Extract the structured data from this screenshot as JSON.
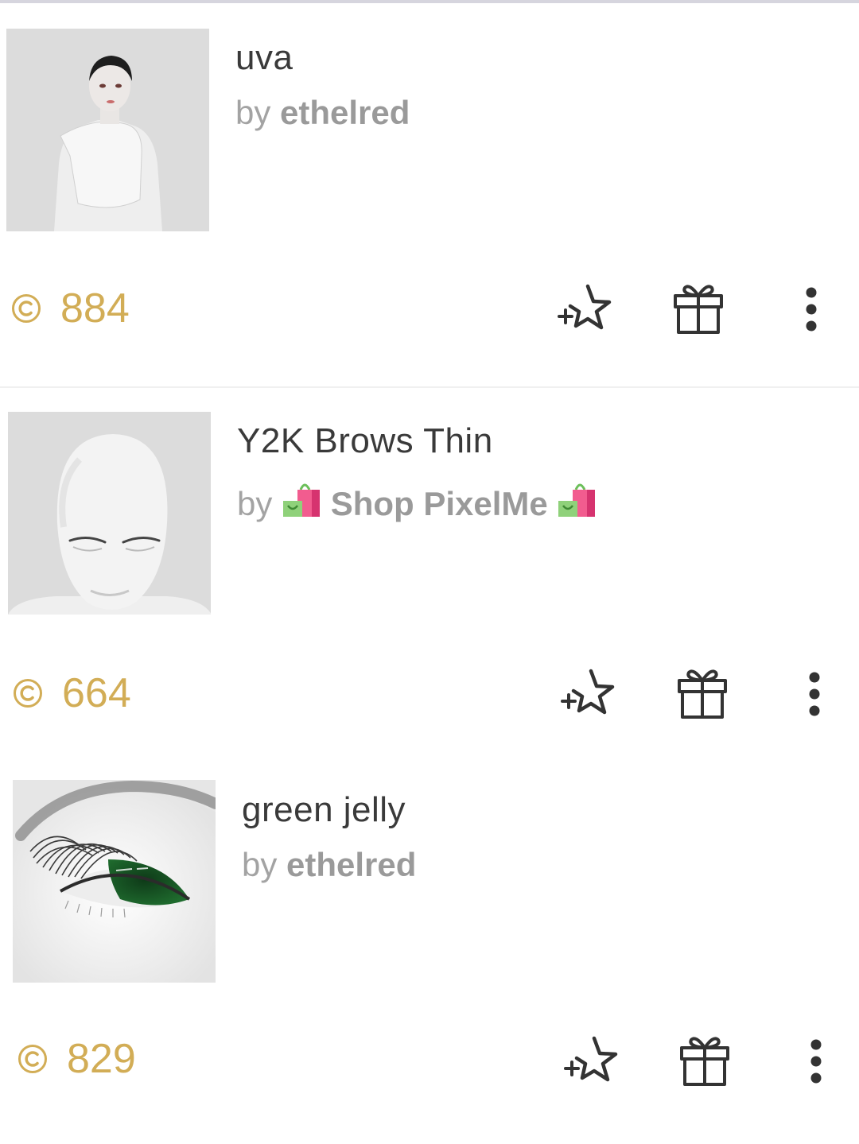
{
  "items": [
    {
      "title": "uva",
      "by": "by",
      "creator": "ethelred",
      "creator_badge": false,
      "price": "884",
      "thumbnail": "mannequin-torso-white-top"
    },
    {
      "title": "Y2K Brows Thin",
      "by": "by",
      "creator": "Shop PixelMe",
      "creator_badge": true,
      "price": "664",
      "thumbnail": "head-with-thin-brows"
    },
    {
      "title": "green jelly",
      "by": "by",
      "creator": "ethelred",
      "creator_badge": false,
      "price": "829",
      "thumbnail": "green-eye-with-lashes"
    }
  ],
  "icons": {
    "currency": "robux-coin-icon",
    "favorite": "star-plus-icon",
    "gift": "gift-icon",
    "more": "vertical-dots-icon",
    "badge": "shopping-bag-icon"
  },
  "colors": {
    "price": "#d2ad56",
    "title": "#3a3a3a",
    "creator": "#a3a3a3",
    "icon": "#333333"
  }
}
